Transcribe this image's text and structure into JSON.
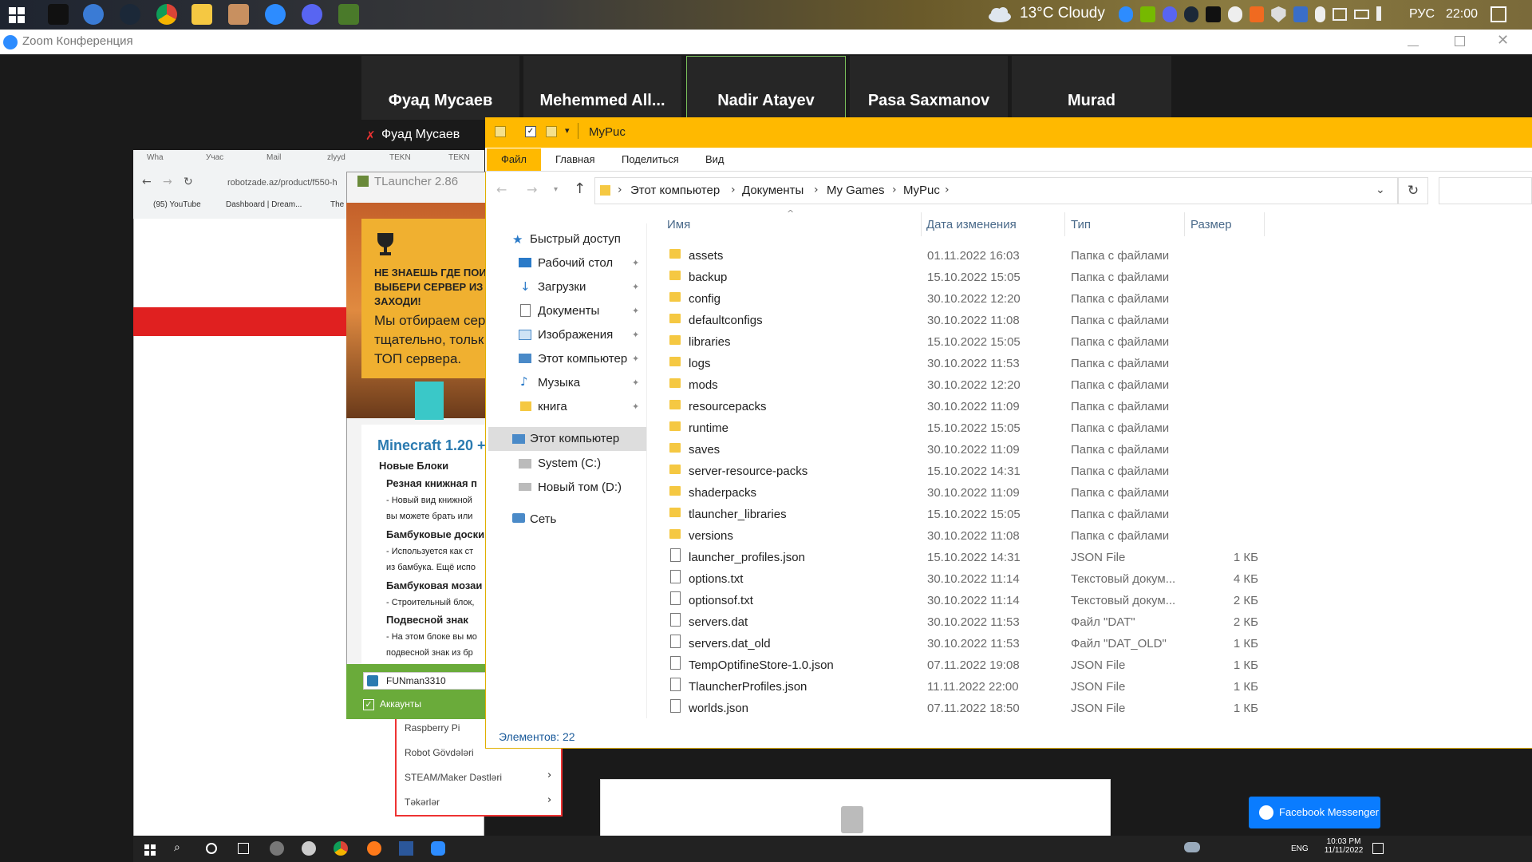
{
  "top_taskbar": {
    "weather": "13°C  Cloudy",
    "lang": "РУС",
    "time": "22:00"
  },
  "zoom": {
    "title": "Zoom Конференция",
    "participants": [
      "Фуад Мусаев",
      "Mehemmed  All...",
      "Nadir Atayev",
      "Pasa Saxmanov",
      "Murad"
    ],
    "active_speaker": "Фуад Мусаев"
  },
  "browser": {
    "tabs": [
      "Wha",
      "Учас",
      "Mail",
      "zlyyd",
      "TEKN",
      "TEKN"
    ],
    "url": "robotzade.az/product/f550-h",
    "bookmarks": [
      "(95) YouTube",
      "Dashboard | Dream...",
      "The"
    ],
    "menu": [
      "Raspberry Pi",
      "Robot Gövdələri",
      "STEAM/Maker Dəstləri",
      "Təkərlər"
    ],
    "messenger": "Facebook Messenger"
  },
  "tlauncher": {
    "title": "TLauncher 2.86",
    "banner_bold": [
      "НЕ ЗНАЕШЬ ГДЕ ПОИ",
      "ВЫБЕРИ СЕРВЕР ИЗ",
      "ЗАХОДИ!"
    ],
    "banner_text": [
      "Мы отбираем сер",
      "тщательно, тольк",
      "ТОП сервера."
    ],
    "news_title": "Minecraft 1.20 +",
    "news": [
      {
        "kind": "h",
        "text": "Новые Блоки"
      },
      {
        "kind": "h2",
        "text": "Резная книжная п"
      },
      {
        "kind": "p",
        "text": "- Новый вид книжной"
      },
      {
        "kind": "p",
        "text": "вы можете брать или"
      },
      {
        "kind": "h2",
        "text": "Бамбуковые доски"
      },
      {
        "kind": "p",
        "text": "- Используется как ст"
      },
      {
        "kind": "p",
        "text": "из бамбука. Ещё испо"
      },
      {
        "kind": "h2",
        "text": "Бамбуковая мозаи"
      },
      {
        "kind": "p",
        "text": "- Строительный блок,"
      },
      {
        "kind": "h2",
        "text": "Подвесной знак"
      },
      {
        "kind": "p",
        "text": "- На этом блоке вы мо"
      },
      {
        "kind": "p",
        "text": "подвесной знак из бр"
      }
    ],
    "username": "FUNman3310",
    "accounts": "Аккаунты"
  },
  "explorer": {
    "title": "MyPuc",
    "ribbon_tabs": [
      "Файл",
      "Главная",
      "Поделиться",
      "Вид"
    ],
    "breadcrumb": [
      "Этот компьютер",
      "Документы",
      "My Games",
      "MyPuc"
    ],
    "nav": [
      {
        "label": "Быстрый доступ",
        "pin": false
      },
      {
        "label": "Рабочий стол",
        "pin": true
      },
      {
        "label": "Загрузки",
        "pin": true
      },
      {
        "label": "Документы",
        "pin": true
      },
      {
        "label": "Изображения",
        "pin": true
      },
      {
        "label": "Этот компьютер",
        "pin": true
      },
      {
        "label": "Музыка",
        "pin": true
      },
      {
        "label": "книга",
        "pin": true
      },
      {
        "label": "Этот компьютер",
        "pin": false
      },
      {
        "label": "System (C:)",
        "pin": false
      },
      {
        "label": "Новый том  (D:)",
        "pin": false
      },
      {
        "label": "Сеть",
        "pin": false
      }
    ],
    "columns": [
      "Имя",
      "Дата изменения",
      "Тип",
      "Размер"
    ],
    "files": [
      {
        "name": "assets",
        "date": "01.11.2022 16:03",
        "type": "Папка с файлами",
        "size": "",
        "icon": "folder"
      },
      {
        "name": "backup",
        "date": "15.10.2022 15:05",
        "type": "Папка с файлами",
        "size": "",
        "icon": "folder"
      },
      {
        "name": "config",
        "date": "30.10.2022 12:20",
        "type": "Папка с файлами",
        "size": "",
        "icon": "folder"
      },
      {
        "name": "defaultconfigs",
        "date": "30.10.2022 11:08",
        "type": "Папка с файлами",
        "size": "",
        "icon": "folder"
      },
      {
        "name": "libraries",
        "date": "15.10.2022 15:05",
        "type": "Папка с файлами",
        "size": "",
        "icon": "folder"
      },
      {
        "name": "logs",
        "date": "30.10.2022 11:53",
        "type": "Папка с файлами",
        "size": "",
        "icon": "folder"
      },
      {
        "name": "mods",
        "date": "30.10.2022 12:20",
        "type": "Папка с файлами",
        "size": "",
        "icon": "folder"
      },
      {
        "name": "resourcepacks",
        "date": "30.10.2022 11:09",
        "type": "Папка с файлами",
        "size": "",
        "icon": "folder"
      },
      {
        "name": "runtime",
        "date": "15.10.2022 15:05",
        "type": "Папка с файлами",
        "size": "",
        "icon": "folder"
      },
      {
        "name": "saves",
        "date": "30.10.2022 11:09",
        "type": "Папка с файлами",
        "size": "",
        "icon": "folder"
      },
      {
        "name": "server-resource-packs",
        "date": "15.10.2022 14:31",
        "type": "Папка с файлами",
        "size": "",
        "icon": "folder"
      },
      {
        "name": "shaderpacks",
        "date": "30.10.2022 11:09",
        "type": "Папка с файлами",
        "size": "",
        "icon": "folder"
      },
      {
        "name": "tlauncher_libraries",
        "date": "15.10.2022 15:05",
        "type": "Папка с файлами",
        "size": "",
        "icon": "folder"
      },
      {
        "name": "versions",
        "date": "30.10.2022 11:08",
        "type": "Папка с файлами",
        "size": "",
        "icon": "folder"
      },
      {
        "name": "launcher_profiles.json",
        "date": "15.10.2022 14:31",
        "type": "JSON File",
        "size": "1 КБ",
        "icon": "json"
      },
      {
        "name": "options.txt",
        "date": "30.10.2022 11:14",
        "type": "Текстовый докум...",
        "size": "4 КБ",
        "icon": "txt"
      },
      {
        "name": "optionsof.txt",
        "date": "30.10.2022 11:14",
        "type": "Текстовый докум...",
        "size": "2 КБ",
        "icon": "txt"
      },
      {
        "name": "servers.dat",
        "date": "30.10.2022 11:53",
        "type": "Файл \"DAT\"",
        "size": "2 КБ",
        "icon": "file"
      },
      {
        "name": "servers.dat_old",
        "date": "30.10.2022 11:53",
        "type": "Файл \"DAT_OLD\"",
        "size": "1 КБ",
        "icon": "file"
      },
      {
        "name": "TempOptifineStore-1.0.json",
        "date": "07.11.2022 19:08",
        "type": "JSON File",
        "size": "1 КБ",
        "icon": "json"
      },
      {
        "name": "TlauncherProfiles.json",
        "date": "11.11.2022 22:00",
        "type": "JSON File",
        "size": "1 КБ",
        "icon": "json"
      },
      {
        "name": "worlds.json",
        "date": "07.11.2022 18:50",
        "type": "JSON File",
        "size": "1 КБ",
        "icon": "json"
      }
    ],
    "status": "Элементов: 22"
  },
  "bottom_taskbar": {
    "lang": "ENG",
    "time": "10:03 PM",
    "date": "11/11/2022"
  }
}
